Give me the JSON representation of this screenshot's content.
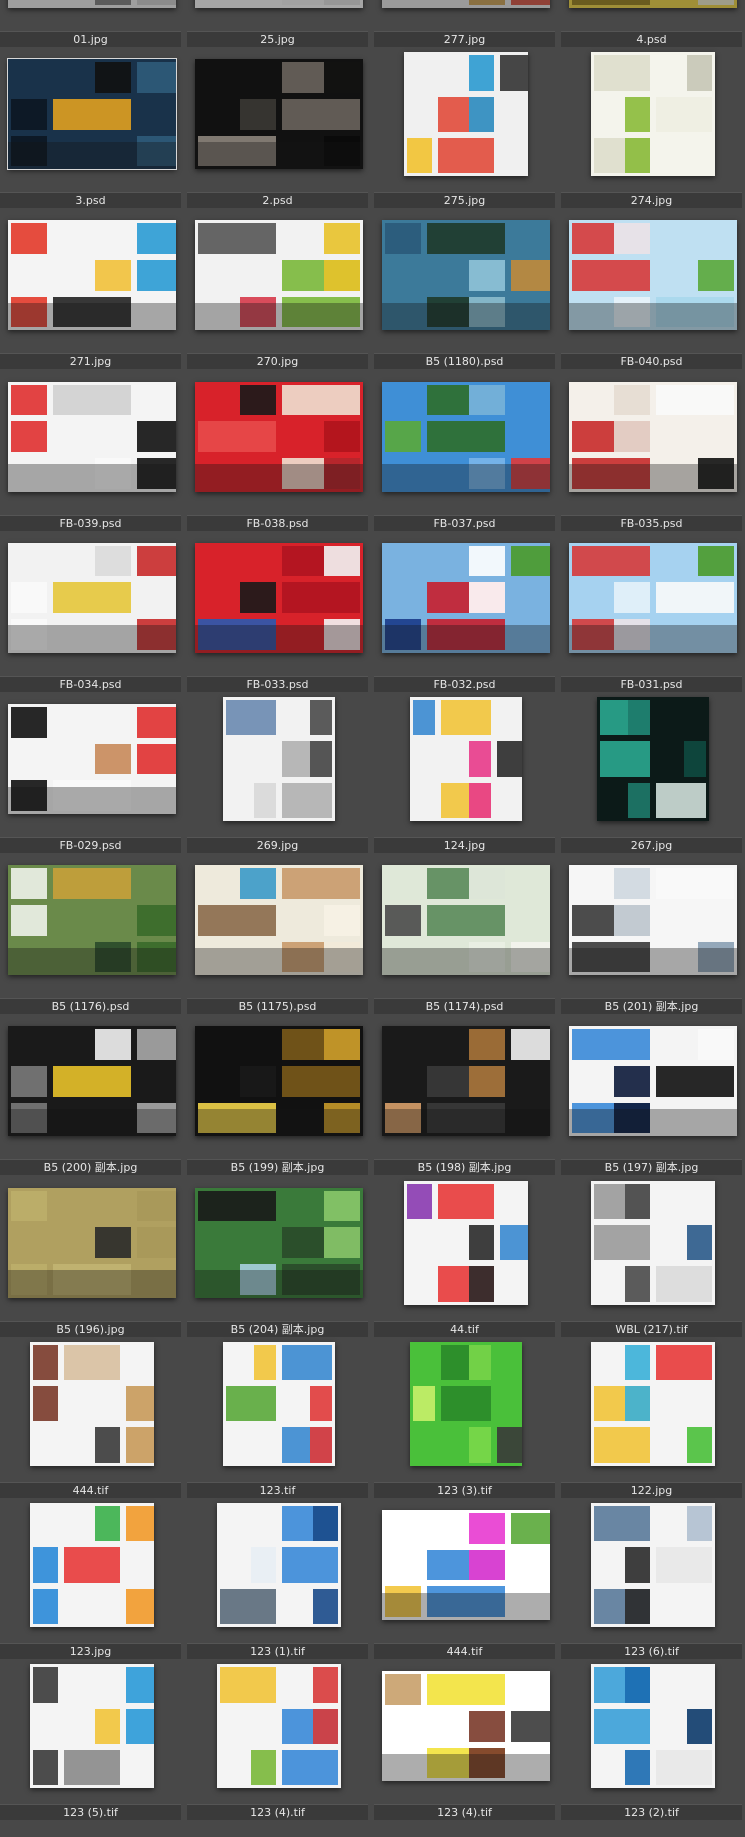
{
  "browser": {
    "thumbnails": [
      {
        "name": "01.jpg",
        "kind": "l",
        "bg": "#e9e9e9",
        "colors": [
          "#1a1a2a",
          "#c8c8c8",
          "#777777",
          "#f2f2f2"
        ],
        "selected": false
      },
      {
        "name": "25.jpg",
        "kind": "l",
        "bg": "#f4f4f4",
        "colors": [
          "#dcdcdc",
          "#eeeeee",
          "#b5b5b5",
          "#fafafa"
        ],
        "selected": false
      },
      {
        "name": "277.jpg",
        "kind": "l",
        "bg": "#e2e2e2",
        "colors": [
          "#c79a4a",
          "#3c3c3c",
          "#6e86b4",
          "#d24b3b"
        ],
        "selected": false
      },
      {
        "name": "4.psd",
        "kind": "l",
        "bg": "#ead24a",
        "colors": [
          "#f2e06a",
          "#8f7a21",
          "#e8e8d8",
          "#b59e35"
        ],
        "selected": false
      },
      {
        "name": "3.psd",
        "kind": "l",
        "bg": "#19324a",
        "colors": [
          "#0c1622",
          "#2f5b7a",
          "#111111",
          "#e0a020"
        ],
        "selected": true
      },
      {
        "name": "2.psd",
        "kind": "l",
        "bg": "#111111",
        "colors": [
          "#0a0a0a",
          "#6a645d",
          "#3b3834",
          "#8d857c"
        ],
        "selected": false
      },
      {
        "name": "275.jpg",
        "kind": "sq",
        "bg": "#f0f0f0",
        "colors": [
          "#2b9ad0",
          "#e14b3b",
          "#f2c230",
          "#333333"
        ],
        "selected": false
      },
      {
        "name": "274.jpg",
        "kind": "sq",
        "bg": "#f4f4ec",
        "colors": [
          "#8bbb3a",
          "#dedecc",
          "#c6c6b6",
          "#eeeee2"
        ],
        "selected": false
      },
      {
        "name": "271.jpg",
        "kind": "l",
        "bg": "#f4f4f4",
        "colors": [
          "#e33a2a",
          "#2a9bd4",
          "#f2c13a",
          "#222222"
        ],
        "selected": false
      },
      {
        "name": "270.jpg",
        "kind": "l",
        "bg": "#f2f2f2",
        "colors": [
          "#e8c22a",
          "#7ab83a",
          "#d63a4a",
          "#555555"
        ],
        "selected": false
      },
      {
        "name": "B5 (1180).psd",
        "kind": "l",
        "bg": "#3c7a9a",
        "colors": [
          "#8fc3d8",
          "#1e3a2a",
          "#2a5a7a",
          "#c08a3a"
        ],
        "selected": false
      },
      {
        "name": "FB-040.psd",
        "kind": "l",
        "bg": "#bfe0f2",
        "colors": [
          "#e9f3fa",
          "#d63a3a",
          "#5aa83a",
          "#a8d8ec"
        ],
        "selected": false
      },
      {
        "name": "FB-039.psd",
        "kind": "l",
        "bg": "#f4f4f4",
        "colors": [
          "#e03030",
          "#111111",
          "#fafafa",
          "#d0d0d0"
        ],
        "selected": false
      },
      {
        "name": "FB-038.psd",
        "kind": "l",
        "bg": "#d8222a",
        "colors": [
          "#b0141c",
          "#f0e0d0",
          "#1a1a1a",
          "#e84a4a"
        ],
        "selected": false
      },
      {
        "name": "FB-037.psd",
        "kind": "l",
        "bg": "#3f8fd6",
        "colors": [
          "#7ab6ea",
          "#2d6e2a",
          "#5aa83a",
          "#e03a3a"
        ],
        "selected": false
      },
      {
        "name": "FB-035.psd",
        "kind": "l",
        "bg": "#f4f0ea",
        "colors": [
          "#e6dcd2",
          "#c82a2a",
          "#111111",
          "#fafafa"
        ],
        "selected": false
      },
      {
        "name": "FB-034.psd",
        "kind": "l",
        "bg": "#f2f2f2",
        "colors": [
          "#fafafa",
          "#c82a2a",
          "#dadada",
          "#e6c63a"
        ],
        "selected": false
      },
      {
        "name": "FB-033.psd",
        "kind": "l",
        "bg": "#d8222a",
        "colors": [
          "#f4f4f4",
          "#b01420",
          "#1a1a1a",
          "#2a5ab0"
        ],
        "selected": false
      },
      {
        "name": "FB-032.psd",
        "kind": "l",
        "bg": "#7ab2e0",
        "colors": [
          "#ffffff",
          "#c81e2e",
          "#1a3a8a",
          "#4a9a2a"
        ],
        "selected": false
      },
      {
        "name": "FB-031.psd",
        "kind": "l",
        "bg": "#a6d2f0",
        "colors": [
          "#e6f2fa",
          "#d63a3a",
          "#4a9a2a",
          "#fafafa"
        ],
        "selected": false
      },
      {
        "name": "FB-029.psd",
        "kind": "l",
        "bg": "#f4f4f4",
        "colors": [
          "#111111",
          "#e03030",
          "#c88a5a",
          "#fafafa"
        ],
        "selected": false
      },
      {
        "name": "269.jpg",
        "kind": "p",
        "bg": "#f2f2f2",
        "colors": [
          "#4a4a4a",
          "#b0b0b0",
          "#d8d8d8",
          "#6a8ab0"
        ],
        "selected": false
      },
      {
        "name": "124.jpg",
        "kind": "p",
        "bg": "#f2f2f2",
        "colors": [
          "#e83a8a",
          "#f2c43a",
          "#3a8ad0",
          "#2a2a2a"
        ],
        "selected": false
      },
      {
        "name": "267.jpg",
        "kind": "p",
        "bg": "#0c1a18",
        "colors": [
          "#1e7a6a",
          "#2aa890",
          "#0e4a40",
          "#d0e0da"
        ],
        "selected": false
      },
      {
        "name": "B5 (1176).psd",
        "kind": "l",
        "bg": "#6a8a4a",
        "colors": [
          "#eef2ea",
          "#3a6a2a",
          "#2a4a2a",
          "#c8a03a"
        ],
        "selected": false
      },
      {
        "name": "B5 (1175).psd",
        "kind": "l",
        "bg": "#eeeadc",
        "colors": [
          "#f6f2e4",
          "#c89a6a",
          "#3a9ac8",
          "#8a6a4a"
        ],
        "selected": false
      },
      {
        "name": "B5 (1174).psd",
        "kind": "l",
        "bg": "#dfe8d8",
        "colors": [
          "#eaf0e4",
          "#5a8a5a",
          "#4a4a4a",
          "#f4f4ee"
        ],
        "selected": false
      },
      {
        "name": "B5 (201) 副本.jpg",
        "kind": "l",
        "bg": "#f6f6f6",
        "colors": [
          "#cfd8e0",
          "#3a3a3a",
          "#8aa0b4",
          "#fafafa"
        ],
        "selected": false
      },
      {
        "name": "B5 (200) 副本.jpg",
        "kind": "l",
        "bg": "#1a1a1a",
        "colors": [
          "#7a7a7a",
          "#a8a8a8",
          "#f2f2f2",
          "#e8c22a"
        ],
        "selected": false
      },
      {
        "name": "B5 (199) 副本.jpg",
        "kind": "l",
        "bg": "#111111",
        "colors": [
          "#c89a2a",
          "#7a5a1a",
          "#1a1a1a",
          "#f2d44a"
        ],
        "selected": false
      },
      {
        "name": "B5 (198) 副本.jpg",
        "kind": "l",
        "bg": "#1a1a1a",
        "colors": [
          "#a8743a",
          "#3a3a3a",
          "#d8a06a",
          "#f2f2f2"
        ],
        "selected": false
      },
      {
        "name": "B5 (197) 副本.jpg",
        "kind": "l",
        "bg": "#f4f4f4",
        "colors": [
          "#0c1a3a",
          "#3a8ad8",
          "#fafafa",
          "#111111"
        ],
        "selected": false
      },
      {
        "name": "B5 (196).jpg",
        "kind": "l",
        "bg": "#b0a060",
        "colors": [
          "#bdae6a",
          "#a8985a",
          "#2a2a2a",
          "#c2b472"
        ],
        "selected": false
      },
      {
        "name": "B5 (204) 副本.jpg",
        "kind": "l",
        "bg": "#3a7a3a",
        "colors": [
          "#8ac86a",
          "#2a4a2a",
          "#a8d0e0",
          "#1a1a1a"
        ],
        "selected": false
      },
      {
        "name": "44.tif",
        "kind": "sq",
        "bg": "#f4f4f4",
        "colors": [
          "#2a2a2a",
          "#e83a3a",
          "#8a3ab0",
          "#3a8ad0"
        ],
        "selected": false
      },
      {
        "name": "WBL (217).tif",
        "kind": "sq",
        "bg": "#f4f4f4",
        "colors": [
          "#4a4a4a",
          "#9a9a9a",
          "#2a5a8a",
          "#dadada"
        ],
        "selected": false
      },
      {
        "name": "444.tif",
        "kind": "sq",
        "bg": "#f4f4f4",
        "colors": [
          "#7a3a2a",
          "#c89a5a",
          "#3a3a3a",
          "#d8c0a0"
        ],
        "selected": false
      },
      {
        "name": "123.tif",
        "kind": "p",
        "bg": "#f4f4f4",
        "colors": [
          "#e03a3a",
          "#3a8ad0",
          "#f2c43a",
          "#5aa83a"
        ],
        "selected": false
      },
      {
        "name": "123 (3).tif",
        "kind": "p",
        "bg": "#4ac03a",
        "colors": [
          "#7ad84a",
          "#2a8a2a",
          "#c8f06a",
          "#3a3a3a"
        ],
        "selected": false
      },
      {
        "name": "122.jpg",
        "kind": "sq",
        "bg": "#f4f4f4",
        "colors": [
          "#3ab0d8",
          "#f2c43a",
          "#4ac03a",
          "#e83a3a"
        ],
        "selected": false
      },
      {
        "name": "123.jpg",
        "kind": "sq",
        "bg": "#f4f4f4",
        "colors": [
          "#2a8ad8",
          "#f29a2a",
          "#3ab04a",
          "#e83a3a"
        ],
        "selected": false
      },
      {
        "name": "123 (1).tif",
        "kind": "sq",
        "bg": "#f4f4f4",
        "colors": [
          "#1a4a8a",
          "#3a8ad8",
          "#e8eef4",
          "#5a6a7a"
        ],
        "selected": false
      },
      {
        "name": "444.tif",
        "kind": "l",
        "bg": "#ffffff",
        "colors": [
          "#e83ad0",
          "#3a8ad8",
          "#f2c43a",
          "#5aa83a"
        ],
        "selected": false
      },
      {
        "name": "123 (6).tif",
        "kind": "sq",
        "bg": "#f4f4f4",
        "colors": [
          "#2a2a2a",
          "#5a7a9a",
          "#b0c0d0",
          "#e8e8e8"
        ],
        "selected": false
      },
      {
        "name": "123 (5).tif",
        "kind": "sq",
        "bg": "#f4f4f4",
        "colors": [
          "#3a3a3a",
          "#2a9ad8",
          "#f2c43a",
          "#8a8a8a"
        ],
        "selected": false
      },
      {
        "name": "123 (4).tif",
        "kind": "sq",
        "bg": "#f4f4f4",
        "colors": [
          "#d83a3a",
          "#3a8ad8",
          "#7ab83a",
          "#f2c43a"
        ],
        "selected": false
      },
      {
        "name": "123 (4).tif",
        "kind": "l",
        "bg": "#ffffff",
        "colors": [
          "#7a3a2a",
          "#f2e23a",
          "#c8a06a",
          "#3a3a3a"
        ],
        "selected": false
      },
      {
        "name": "123 (2).tif",
        "kind": "sq",
        "bg": "#f4f4f4",
        "colors": [
          "#1a6ab0",
          "#3aa0d8",
          "#0c3a6a",
          "#e8e8e8"
        ],
        "selected": false
      }
    ]
  }
}
